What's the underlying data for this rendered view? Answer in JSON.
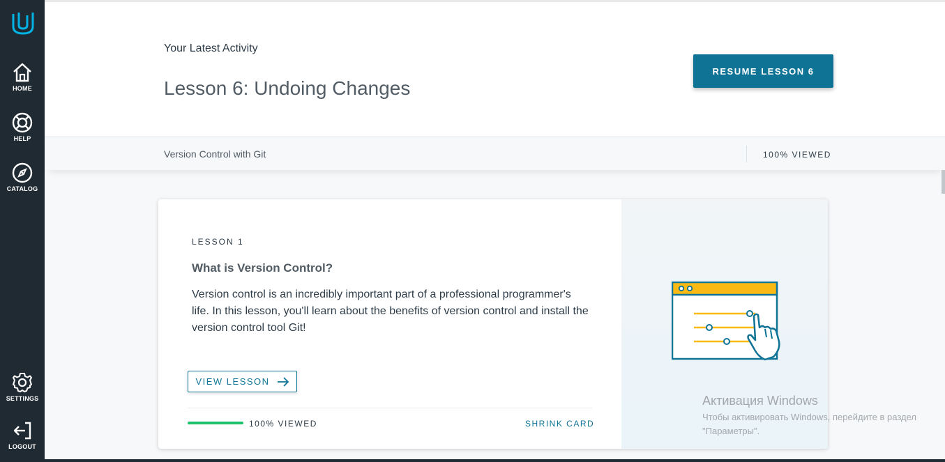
{
  "sidebar": {
    "items": [
      {
        "label": "HOME",
        "icon": "home-icon"
      },
      {
        "label": "HELP",
        "icon": "lifebuoy-icon"
      },
      {
        "label": "CATALOG",
        "icon": "compass-icon"
      },
      {
        "label": "SETTINGS",
        "icon": "gear-icon"
      },
      {
        "label": "LOGOUT",
        "icon": "logout-icon"
      }
    ]
  },
  "header": {
    "latest_label": "Your Latest Activity",
    "lesson_title": "Lesson 6: Undoing Changes",
    "resume_label": "RESUME LESSON 6",
    "course_name": "Version Control with Git",
    "viewed": "100% VIEWED"
  },
  "card": {
    "lesson_num": "LESSON 1",
    "title": "What is Version Control?",
    "description": "Version control is an incredibly important part of a professional programmer's life. In this lesson, you'll learn about the benefits of version control and install the version control tool Git!",
    "view_label": "VIEW LESSON",
    "progress_fraction": 1.0,
    "viewed": "100% VIEWED",
    "shrink_label": "SHRINK CARD"
  },
  "watermark": {
    "title": "Активация Windows",
    "text": "Чтобы активировать Windows, перейдите в раздел \"Параметры\"."
  },
  "colors": {
    "sidebar_bg": "#1f2a33",
    "accent": "#0f7396",
    "brand_logo": "#02b3e4",
    "progress": "#1ec26d",
    "illustration_yellow": "#fbb914"
  }
}
